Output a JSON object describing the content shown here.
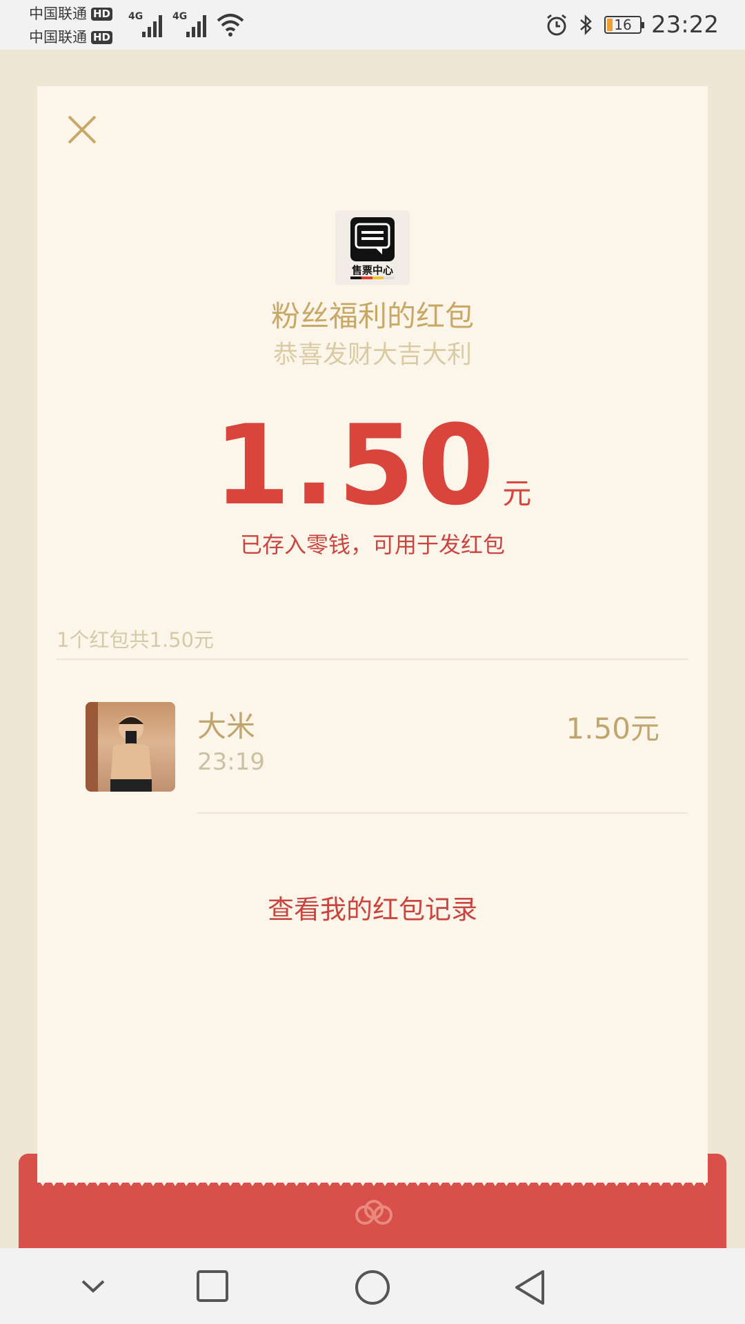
{
  "status_bar": {
    "carrier1": "中国联通",
    "carrier2": "中国联通",
    "hd_badge": "HD",
    "network": "4G",
    "battery_level": "16",
    "time": "23:22"
  },
  "envelope": {
    "sender_name": "粉丝福利的红包",
    "greeting": "恭喜发财大吉大利",
    "logo_text": "售票中心",
    "amount": "1.50",
    "unit": "元",
    "amount_note": "已存入零钱，可用于发红包",
    "summary": "1个红包共1.50元",
    "records": [
      {
        "name": "大米",
        "time": "23:19",
        "amount": "1.50元"
      }
    ],
    "view_records_link": "查看我的红包记录"
  },
  "colors": {
    "accent_red": "#D9443C",
    "gold_text": "#C9A867",
    "card_bg": "#FCF6EA",
    "envelope_red": "#D9504A"
  },
  "icons": [
    "close-icon",
    "alarm-icon",
    "bluetooth-icon",
    "wifi-icon",
    "signal-icon",
    "battery-icon",
    "chat-logo-icon",
    "back-chevron-icon",
    "home-icon",
    "recent-apps-icon",
    "navigate-back-icon"
  ]
}
